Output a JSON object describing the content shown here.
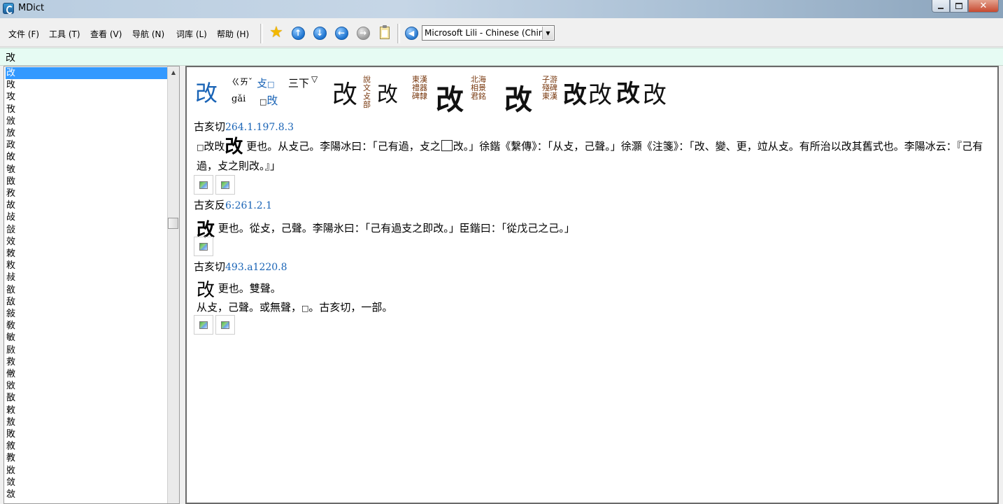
{
  "window": {
    "title": "MDict"
  },
  "menu": {
    "file": "文件 (F)",
    "tools": "工具 (T)",
    "view": "查看 (V)",
    "navigate": "导航 (N)",
    "library": "词库 (L)",
    "help": "帮助 (H)"
  },
  "toolbar": {
    "icons": [
      "favorite-star-icon",
      "up-arrow-icon",
      "down-arrow-icon",
      "back-arrow-icon",
      "forward-arrow-icon",
      "clipboard-icon",
      "speaker-icon"
    ],
    "voice": "Microsoft Lili - Chinese (China)"
  },
  "search": {
    "value": "改"
  },
  "wordlist": {
    "items": [
      "改",
      "攺",
      "攻",
      "攼",
      "攽",
      "放",
      "政",
      "敀",
      "敂",
      "敃",
      "敄",
      "故",
      "敁",
      "敆",
      "效",
      "敇",
      "敉",
      "敊",
      "敋",
      "敌",
      "敍",
      "敎",
      "敏",
      "敐",
      "救",
      "敒",
      "敓",
      "敔",
      "敕",
      "敖",
      "敗",
      "敘",
      "教",
      "敚",
      "敛",
      "敜"
    ],
    "selected_index": 0
  },
  "entry": {
    "head": "改",
    "bopomofo": "ㄍㄞˇ",
    "pinyin": "gǎi",
    "radical": "攴",
    "radical_box": "□",
    "variant": "攺",
    "variant_box": "□",
    "strokes": "三下",
    "marker": "▽",
    "seal_forms": [
      "改",
      "改",
      "改",
      "改",
      "改",
      "改",
      "改",
      "改"
    ],
    "seal_notes": [
      "說文攴部",
      "東漢禮器碑隸",
      "北海相景君銘",
      "漢隸",
      "子游殘碑東漢"
    ],
    "sections": [
      {
        "fanqie": "古亥切",
        "ref": "264.1.197.8.3",
        "box_char": "□",
        "prefix": "改攺",
        "glyph": "改",
        "def": "更也。从攴己。李陽冰曰：「己有過，攴之",
        "def_tail": "改。」徐鍇《繫傳》：「从攴，己聲。」徐灝《注箋》：「改、變、更，竝从攴。有所治以改其舊式也。李陽冰云：『己有過，攴之則改。』」",
        "images": 2
      },
      {
        "fanqie": "古亥反",
        "ref": "6:261.2.1",
        "glyph": "改",
        "def": "更也。從攴，己聲。李陽氷曰：「己有過支之即改。」臣鍇曰：「從戊己之己。」",
        "images": 1
      },
      {
        "fanqie": "古亥切",
        "ref": "493.a1220.8",
        "glyph": "改",
        "def": "更也。雙聲。",
        "def2": "从攴，己聲。或無聲，",
        "box_char": "□",
        "def2_tail": "。古亥切，一部。",
        "images": 2
      }
    ]
  }
}
